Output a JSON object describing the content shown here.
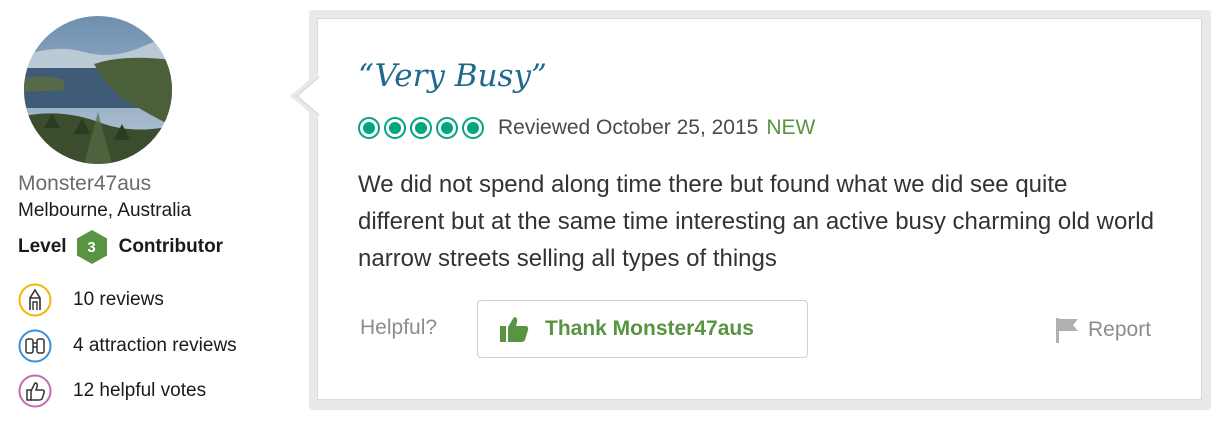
{
  "member": {
    "username": "Monster47aus",
    "location": "Melbourne, Australia",
    "level_prefix": "Level",
    "level_number": "3",
    "level_suffix": "Contributor",
    "stats": [
      {
        "icon": "pencil-icon",
        "text": "10 reviews"
      },
      {
        "icon": "binoculars-icon",
        "text": "4 attraction reviews"
      },
      {
        "icon": "thumbs-up-icon",
        "text": "12 helpful votes"
      }
    ]
  },
  "review": {
    "title": "“Very Busy”",
    "rating": 5,
    "rating_max": 5,
    "reviewed": "Reviewed October 25, 2015",
    "new_label": "NEW",
    "body": "We did not spend along time there but found what we did see quite different but at the same time interesting an active busy charming old world narrow streets selling all types of things"
  },
  "actions": {
    "helpful_label": "Helpful?",
    "thank_label": "Thank Monster47aus",
    "report_label": "Report"
  },
  "colors": {
    "accent_green": "#589442",
    "bubble_green": "#00a680",
    "title_blue": "#1f6a8c"
  }
}
